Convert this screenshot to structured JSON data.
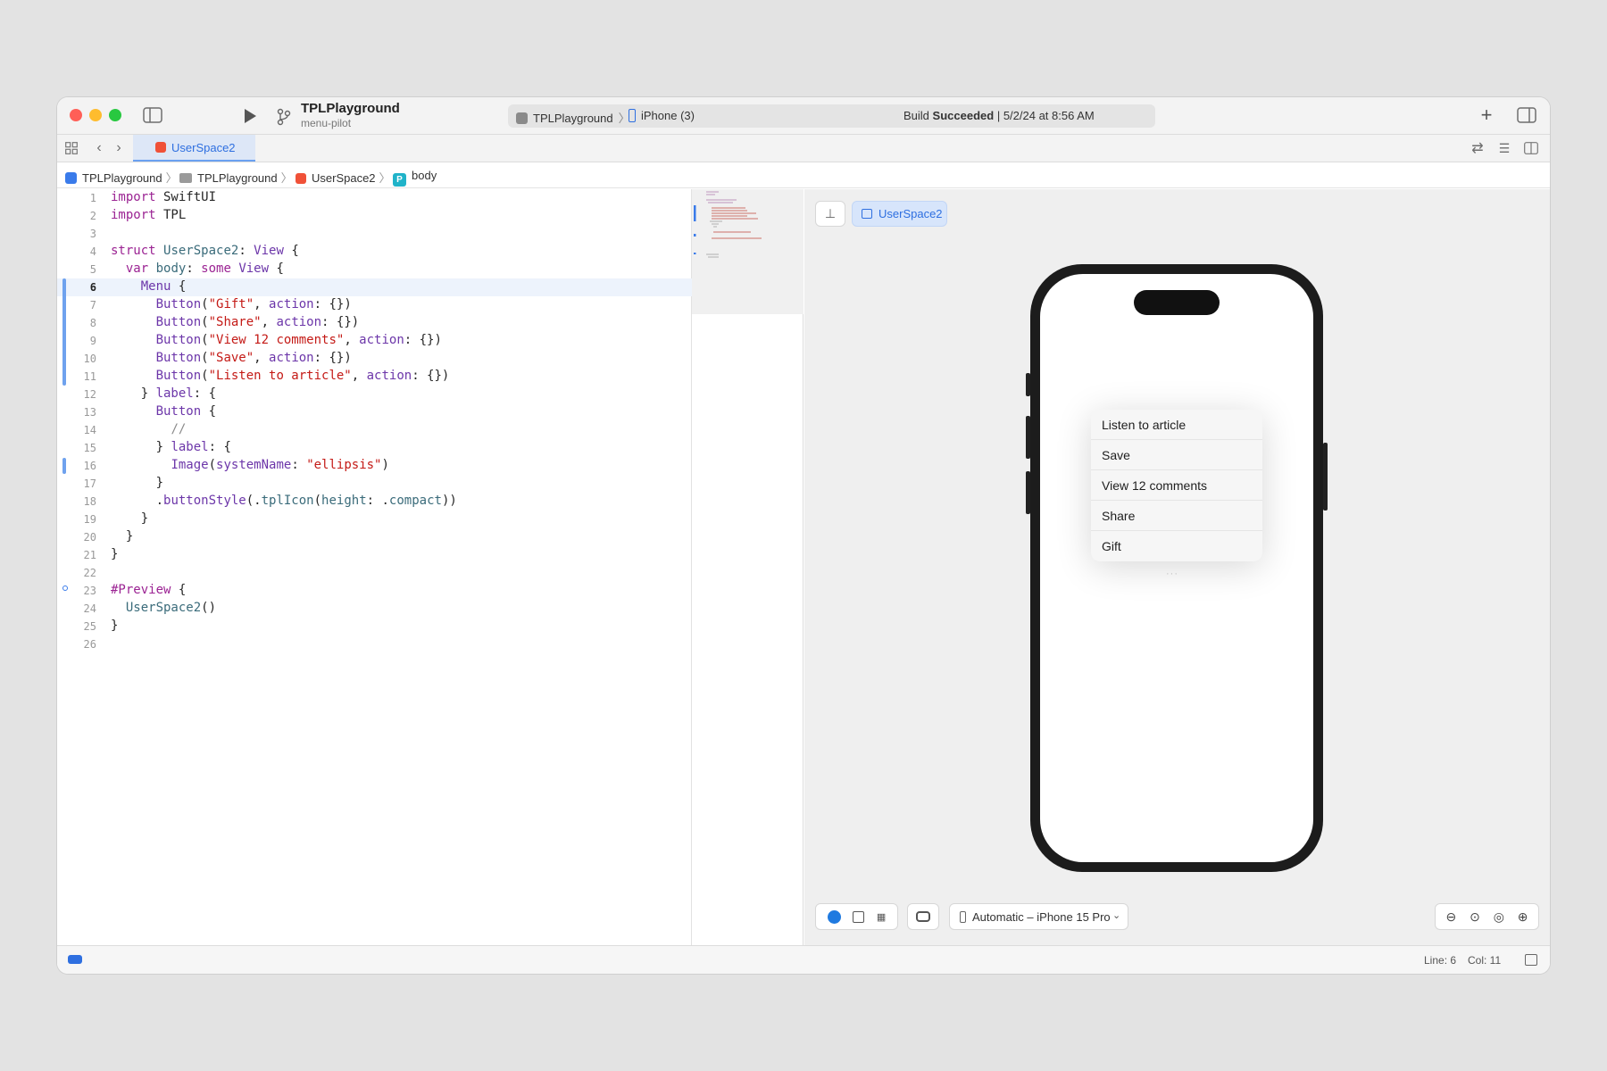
{
  "titlebar": {
    "project_name": "TPLPlayground",
    "branch": "menu-pilot",
    "scheme_target": "TPLPlayground",
    "device": "iPhone (3)",
    "build_prefix": "Build",
    "build_status": "Succeeded",
    "build_time": "| 5/2/24 at 8:56 AM"
  },
  "tab": {
    "label": "UserSpace2"
  },
  "breadcrumbs": [
    "TPLPlayground",
    "TPLPlayground",
    "UserSpace2",
    "body"
  ],
  "editor": {
    "lines": [
      {
        "n": "1",
        "html": "<span class=\"kw\">import</span> SwiftUI"
      },
      {
        "n": "2",
        "html": "<span class=\"kw\">import</span> TPL"
      },
      {
        "n": "3",
        "html": ""
      },
      {
        "n": "4",
        "html": "<span class=\"kw\">struct</span> <span class=\"ty\">UserSpace2</span>: <span class=\"pl\">View</span> {"
      },
      {
        "n": "5",
        "html": "  <span class=\"kw\">var</span> <span class=\"ty\">body</span>: <span class=\"kw\">some</span> <span class=\"pl\">View</span> {"
      },
      {
        "n": "6",
        "html": "    <span class=\"pl\">Menu</span> {"
      },
      {
        "n": "7",
        "html": "      <span class=\"pl\">Button</span>(<span class=\"st\">\"Gift\"</span>, <span class=\"pl\">action</span>: {})"
      },
      {
        "n": "8",
        "html": "      <span class=\"pl\">Button</span>(<span class=\"st\">\"Share\"</span>, <span class=\"pl\">action</span>: {})"
      },
      {
        "n": "9",
        "html": "      <span class=\"pl\">Button</span>(<span class=\"st\">\"View 12 comments\"</span>, <span class=\"pl\">action</span>: {})"
      },
      {
        "n": "10",
        "html": "      <span class=\"pl\">Button</span>(<span class=\"st\">\"Save\"</span>, <span class=\"pl\">action</span>: {})"
      },
      {
        "n": "11",
        "html": "      <span class=\"pl\">Button</span>(<span class=\"st\">\"Listen to article\"</span>, <span class=\"pl\">action</span>: {})"
      },
      {
        "n": "12",
        "html": "    } <span class=\"pl\">label</span>: {"
      },
      {
        "n": "13",
        "html": "      <span class=\"pl\">Button</span> {"
      },
      {
        "n": "14",
        "html": "        <span class=\"cm\">//</span>"
      },
      {
        "n": "15",
        "html": "      } <span class=\"pl\">label</span>: {"
      },
      {
        "n": "16",
        "html": "        <span class=\"pl\">Image</span>(<span class=\"pl\">systemName</span>: <span class=\"st\">\"ellipsis\"</span>)"
      },
      {
        "n": "17",
        "html": "      }"
      },
      {
        "n": "18",
        "html": "      .<span class=\"pl\">buttonStyle</span>(.<span class=\"ty\">tplIcon</span>(<span class=\"ty\">height</span>: .<span class=\"ty\">compact</span>))"
      },
      {
        "n": "19",
        "html": "    }"
      },
      {
        "n": "20",
        "html": "  }"
      },
      {
        "n": "21",
        "html": "}"
      },
      {
        "n": "22",
        "html": ""
      },
      {
        "n": "23",
        "html": "<span class=\"kw\">#Preview</span> {"
      },
      {
        "n": "24",
        "html": "  <span class=\"ty\">UserSpace2</span>()"
      },
      {
        "n": "25",
        "html": "}"
      },
      {
        "n": "26",
        "html": ""
      }
    ],
    "current_line": "6"
  },
  "preview": {
    "chip_label": "UserSpace2",
    "device_selector": "Automatic – iPhone 15 Pro",
    "menu_items": [
      "Listen to article",
      "Save",
      "View 12 comments",
      "Share",
      "Gift"
    ],
    "ellipsis": "···"
  },
  "status": {
    "line": "Line: 6",
    "col": "Col: 11"
  },
  "colors": {
    "accent": "#2e6fe0",
    "close": "#ff5f57",
    "minimize": "#febc2e",
    "zoom": "#28c840"
  }
}
